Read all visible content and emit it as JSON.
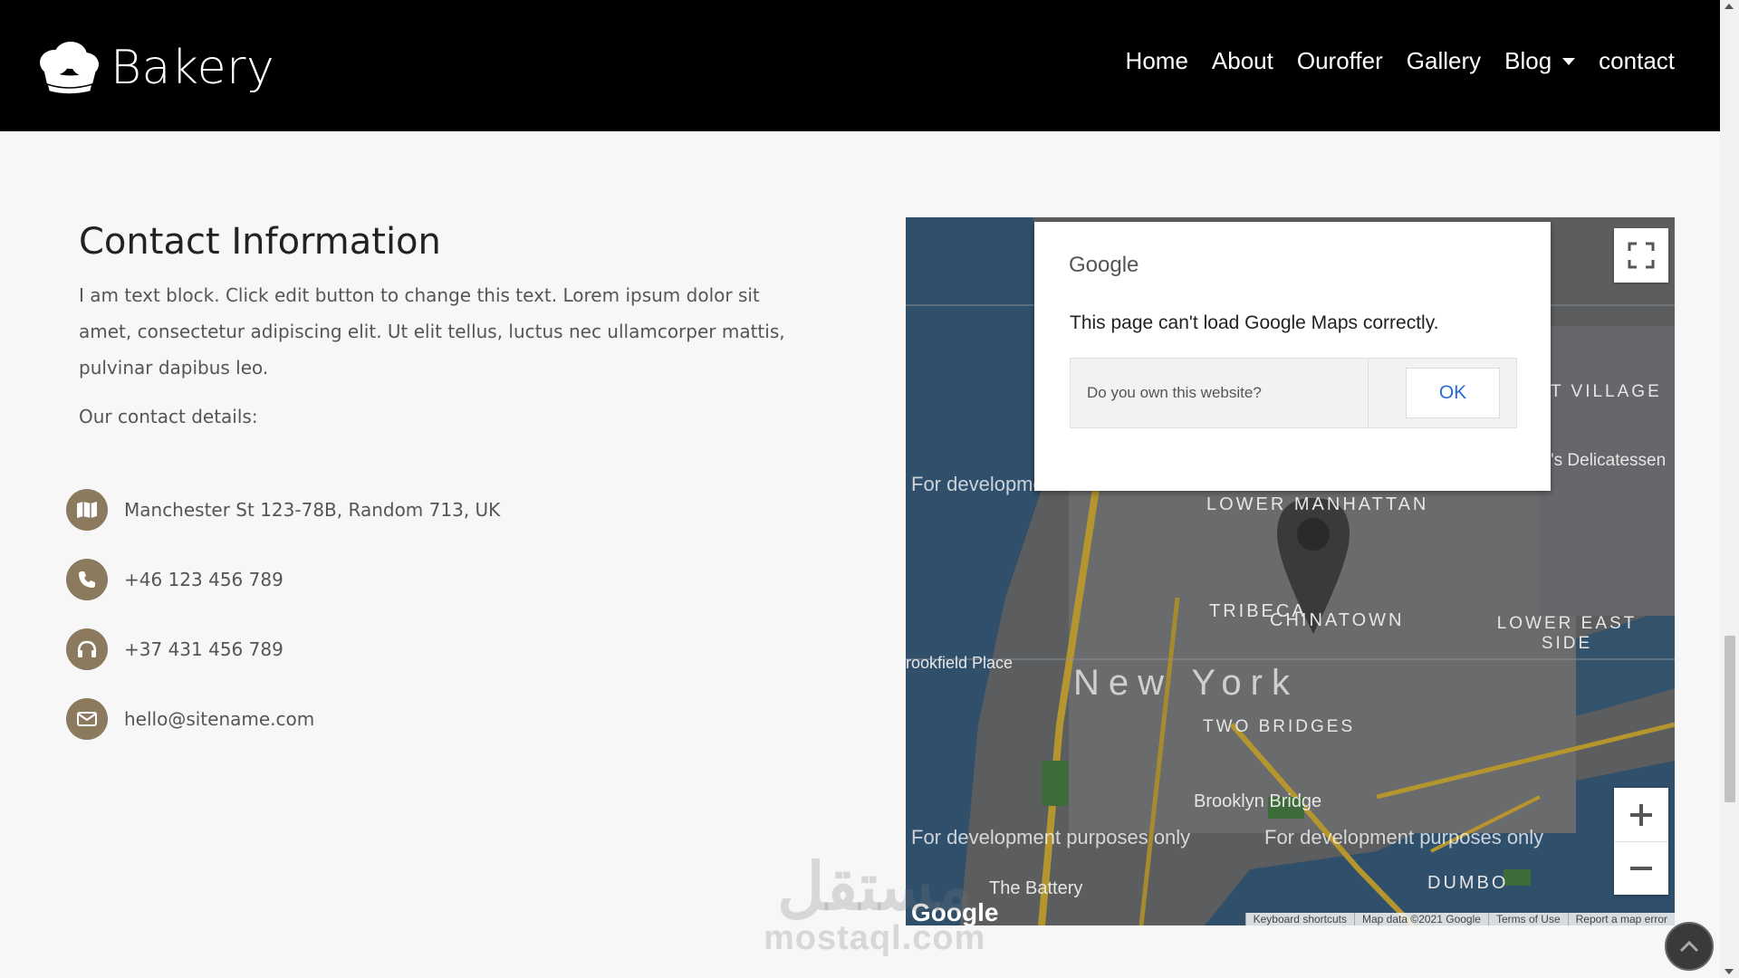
{
  "header": {
    "logo_text": "Bakery",
    "nav": [
      {
        "label": "Home"
      },
      {
        "label": "About"
      },
      {
        "label": "Ouroffer"
      },
      {
        "label": "Gallery"
      },
      {
        "label": "Blog",
        "dropdown": true
      },
      {
        "label": "contact"
      }
    ]
  },
  "contact": {
    "title": "Contact Information",
    "description": "I am text block. Click edit button to change this text. Lorem ipsum dolor sit amet, consectetur adipiscing elit. Ut elit tellus, luctus nec ullamcorper mattis, pulvinar dapibus leo.",
    "details_label": "Our contact details:",
    "items": [
      {
        "icon": "map-icon",
        "text": "Manchester St 123-78B, Random 713, UK"
      },
      {
        "icon": "phone-icon",
        "text": "+46 123 456 789"
      },
      {
        "icon": "headphones-icon",
        "text": "+37 431 456 789"
      },
      {
        "icon": "envelope-icon",
        "text": "hello@sitename.com"
      }
    ],
    "icon_color": "#8b7a5e"
  },
  "map": {
    "dialog": {
      "brand": "Google",
      "message": "This page can't load Google Maps correctly.",
      "question": "Do you own this website?",
      "ok": "OK"
    },
    "dev_text": "For development purposes only",
    "labels": {
      "lower_manhattan": "LOWER MANHATTAN",
      "tribeca": "TRIBECA",
      "chinatown": "CHINATOWN",
      "lower_east_side": "LOWER EAST SIDE",
      "new_york": "New York",
      "two_bridges": "TWO BRIDGES",
      "brooklyn_bridge": "Brooklyn Bridge",
      "dumbo": "DUMBO",
      "the_battery": "The Battery",
      "brookfield_place": "rookfield Place",
      "village": "T VILLAGE",
      "delicatessen": "'s Delicatessen"
    },
    "logo": "Google",
    "footer": [
      "Keyboard shortcuts",
      "Map data ©2021 Google",
      "Terms of Use",
      "Report a map error"
    ]
  },
  "watermark": {
    "arabic": "مستقل",
    "latin": "mostaql.com"
  }
}
